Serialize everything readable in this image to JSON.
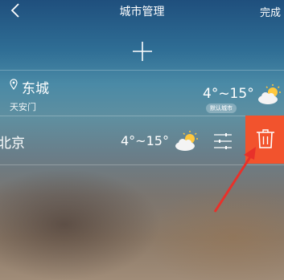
{
  "header": {
    "title": "城市管理",
    "done_label": "完成"
  },
  "current_city": {
    "name": "东城",
    "district": "天安门",
    "temp": "4°~15°",
    "badge": "默认城市",
    "weather_icon": "partly-cloudy-icon"
  },
  "city_row": {
    "name": "北京",
    "temp": "4°~15°",
    "weather_icon": "partly-cloudy-icon"
  },
  "colors": {
    "delete_bg": "#f2532d",
    "arrow": "#e8312a",
    "sun": "#ffc83d"
  }
}
